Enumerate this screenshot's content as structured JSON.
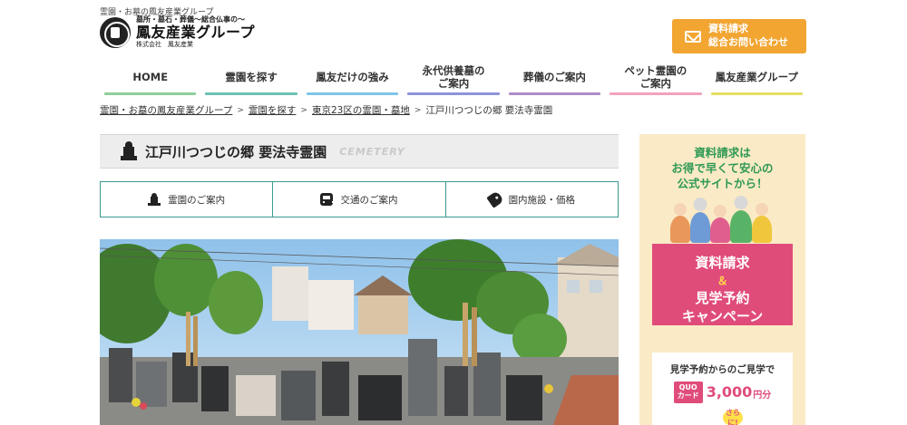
{
  "header": {
    "tagline": "霊園・お墓の鳳友産業グループ",
    "logo_sub1": "墓所・墓石・葬儀〜総合仏事の〜",
    "logo_main": "鳳友産業グループ",
    "logo_sub2": "株式会社　鳳友産業",
    "cta_line1": "資料請求",
    "cta_line2": "総合お問い合わせ",
    "cta_color": "#f2a531"
  },
  "nav": {
    "items": [
      {
        "label": "HOME",
        "color": "#8fcf9a"
      },
      {
        "label": "霊園を探す",
        "color": "#6cc2b4"
      },
      {
        "label": "鳳友だけの強み",
        "color": "#7fc6e6"
      },
      {
        "label": "永代供養墓の\nご案内",
        "color": "#8d94d8"
      },
      {
        "label": "葬儀のご案内",
        "color": "#b08cc9"
      },
      {
        "label": "ペット霊園の\nご案内",
        "color": "#f2a2c0"
      },
      {
        "label": "鳳友産業グループ",
        "color": "#e5de63"
      }
    ]
  },
  "breadcrumb": {
    "items": [
      "霊園・お墓の鳳友産業グループ",
      "霊園を探す",
      "東京23区の霊園・墓地"
    ],
    "separator": ">",
    "current": "江戸川つつじの郷 要法寺霊園"
  },
  "page": {
    "title": "江戸川つつじの郷 要法寺霊園",
    "title_en": "CEMETERY"
  },
  "tabs": [
    {
      "label": "霊園のご案内",
      "icon": "grave-icon"
    },
    {
      "label": "交通のご案内",
      "icon": "train-icon"
    },
    {
      "label": "園内施設・価格",
      "icon": "price-tag-icon"
    }
  ],
  "sidebar": {
    "head_line1": "資料請求は",
    "head_line2": "お得で早くて安心の",
    "head_line3": "公式サイトから！",
    "campaign_line1": "資料請求",
    "campaign_amp": "＆",
    "campaign_line2": "見学予約",
    "campaign_line3": "キャンペーン",
    "offer_note": "見学予約からのご見学で",
    "quo_line1": "QUO",
    "quo_line2": "カード",
    "amount": "3,000",
    "amount_unit": "円分",
    "sarani": "さらに!",
    "accent": "#e04c7a",
    "head_color": "#2f9a55"
  }
}
